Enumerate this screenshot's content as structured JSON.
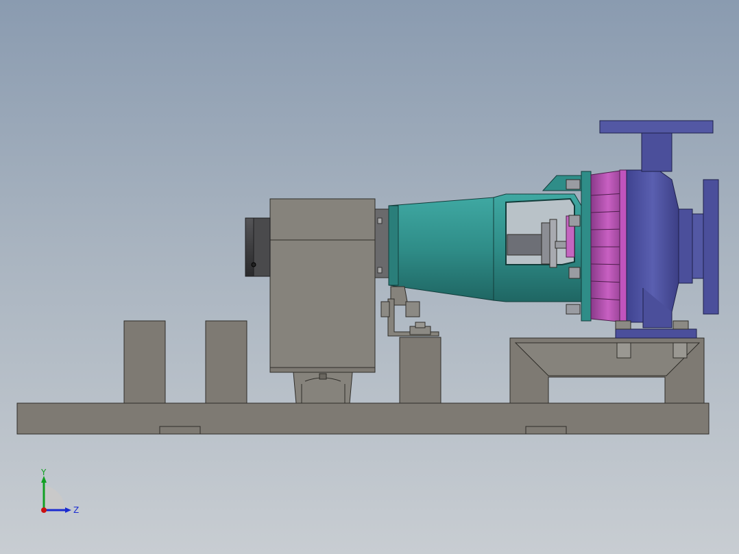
{
  "app": {
    "view": "Right"
  },
  "model": {
    "name": "pump-assembly",
    "colors": {
      "background_top": "#8a9bb0",
      "background_bottom": "#c8cdd2",
      "base_steel": "#7e7a73",
      "motor_gray": "#86837c",
      "bearing_teal": "#2f8d88",
      "casing_blue": "#4b4f9b",
      "impeller_pink": "#b44fb0",
      "coupling_dark": "#3e3e40"
    },
    "parts": [
      {
        "label": "baseplate"
      },
      {
        "label": "motor"
      },
      {
        "label": "bearing-frame"
      },
      {
        "label": "pump-casing"
      },
      {
        "label": "discharge-flange"
      },
      {
        "label": "suction-flange"
      },
      {
        "label": "pump-support"
      }
    ]
  },
  "triad": {
    "y_label": "Y",
    "z_label": "Z",
    "colors": {
      "y": "#11a022",
      "z": "#1a2bd0",
      "x": "#cc1111"
    }
  }
}
